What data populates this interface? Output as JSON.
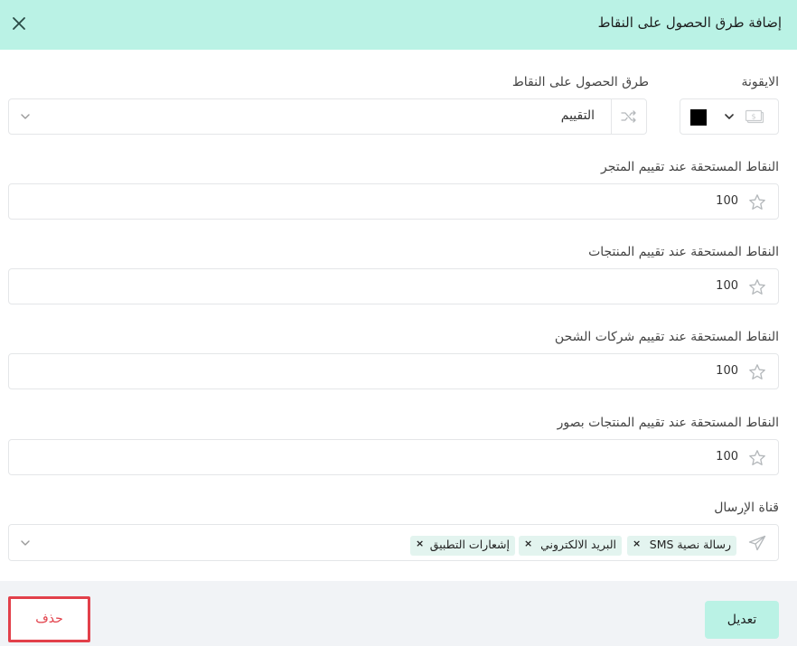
{
  "dialog": {
    "title": "إضافة طرق الحصول على النقاط",
    "close_icon": "close-icon"
  },
  "icon_field": {
    "label": "الايقونة",
    "selected_color": "#000000",
    "icon": "money-icon"
  },
  "method_field": {
    "label": "طرق الحصول على النقاط",
    "value": "التقييم",
    "icon": "shuffle-icon"
  },
  "store_rating": {
    "label": "النقاط المستحقة عند تقييم المتجر",
    "value": "100"
  },
  "product_rating": {
    "label": "النقاط المستحقة عند تقييم المنتجات",
    "value": "100"
  },
  "shipping_rating": {
    "label": "النقاط المستحقة عند تقييم شركات الشحن",
    "value": "100"
  },
  "photo_rating": {
    "label": "النقاط المستحقة عند تقييم المنتجات بصور",
    "value": "100"
  },
  "channel_field": {
    "label": "قناة الإرسال",
    "tags": [
      "رسالة نصية SMS",
      "البريد الالكتروني",
      "إشعارات التطبيق"
    ],
    "tag_remove": "×"
  },
  "footer": {
    "edit_label": "تعديل",
    "delete_label": "حذف"
  },
  "colors": {
    "accent": "#baf2e5",
    "danger": "#e2404a",
    "tag_bg": "#e3f4ef"
  }
}
